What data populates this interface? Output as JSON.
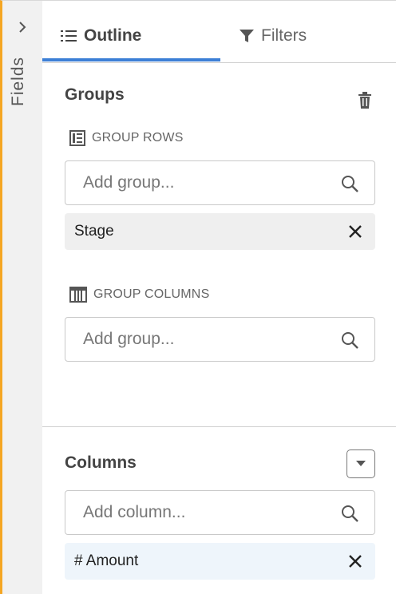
{
  "rail": {
    "label": "Fields"
  },
  "tabs": {
    "outline": "Outline",
    "filters": "Filters"
  },
  "groups": {
    "title": "Groups",
    "rows_label": "GROUP ROWS",
    "rows_placeholder": "Add group...",
    "rows_items": [
      "Stage"
    ],
    "columns_label": "GROUP COLUMNS",
    "columns_placeholder": "Add group..."
  },
  "columns": {
    "title": "Columns",
    "placeholder": "Add column...",
    "items": [
      "# Amount"
    ]
  },
  "colors": {
    "accent": "#3c7fd6",
    "rail_edge": "#f5a623"
  }
}
